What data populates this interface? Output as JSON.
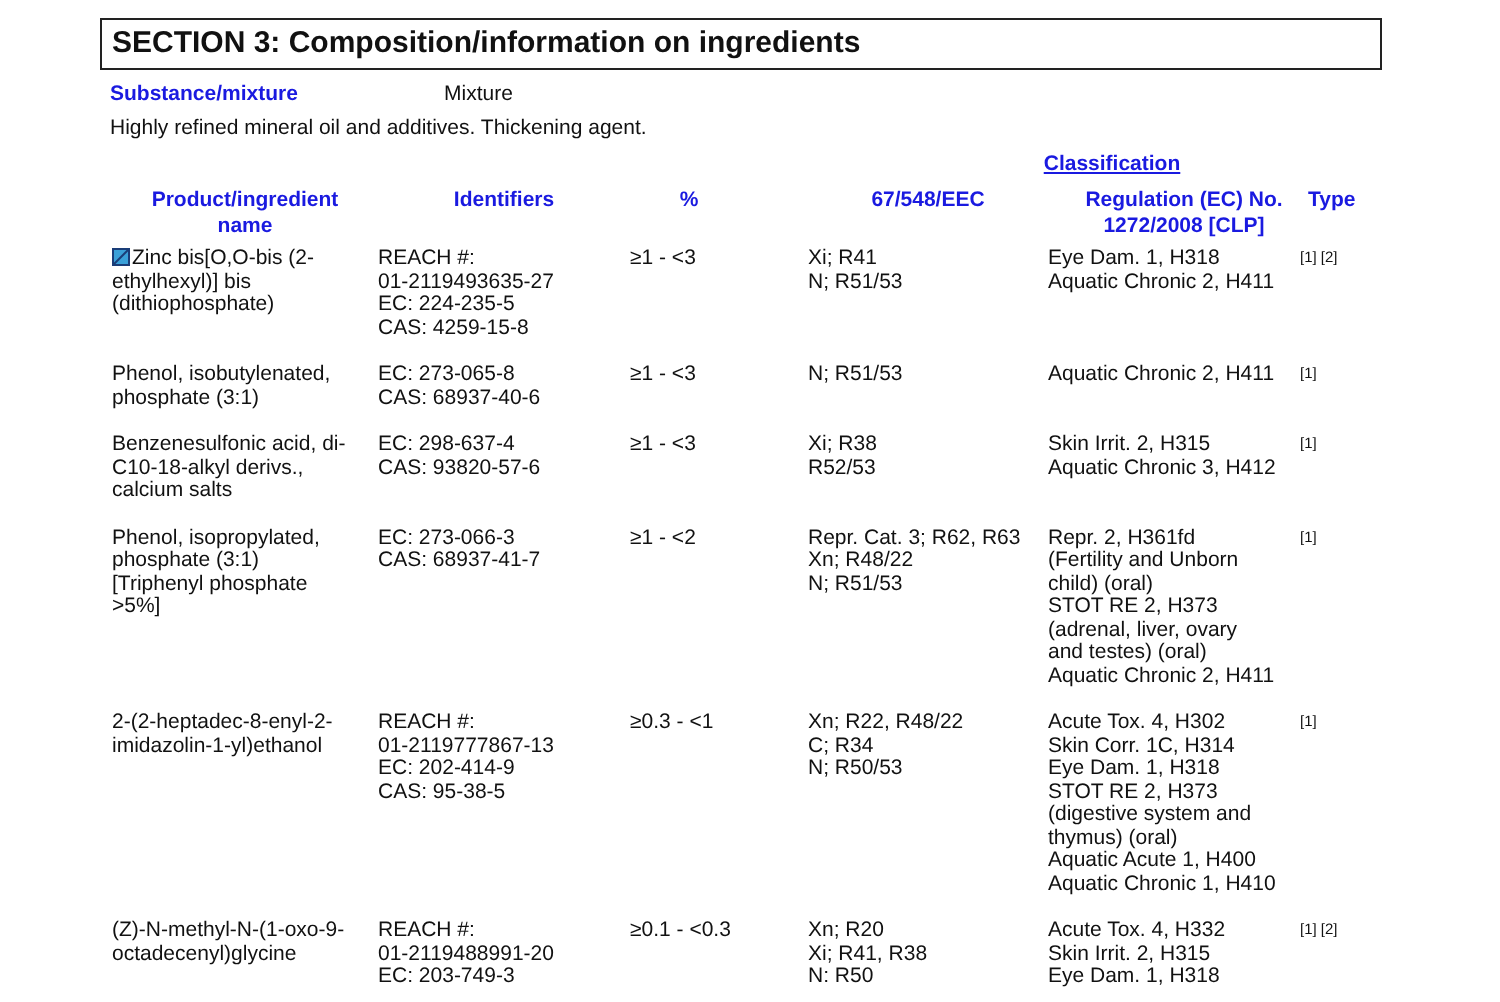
{
  "section_title": "SECTION 3: Composition/information on ingredients",
  "substance": {
    "label": "Substance/mixture",
    "value": "Mixture"
  },
  "description": "Highly refined mineral oil and additives.  Thickening agent.",
  "table": {
    "group_heading": "Classification",
    "columns": [
      "Product/ingredient name",
      "Identifiers",
      "%",
      "67/548/EEC",
      "Regulation (EC) No. 1272/2008 [CLP]",
      "Type"
    ],
    "rows": [
      {
        "note_marker": true,
        "name": "Zinc bis[O,O-bis (2-ethylhexyl)] bis (dithiophosphate)",
        "identifiers": [
          "REACH #:",
          "01-2119493635-27",
          "EC: 224-235-5",
          "CAS: 4259-15-8"
        ],
        "percent": "≥1 - <3",
        "eec": [
          "Xi; R41",
          "N; R51/53"
        ],
        "clp": [
          "Eye Dam. 1, H318",
          "Aquatic Chronic 2, H411"
        ],
        "type": "[1] [2]"
      },
      {
        "note_marker": false,
        "name": "Phenol, isobutylenated, phosphate (3:1)",
        "identifiers": [
          "EC: 273-065-8",
          "CAS: 68937-40-6"
        ],
        "percent": "≥1 - <3",
        "eec": [
          "N; R51/53"
        ],
        "clp": [
          "Aquatic Chronic 2, H411"
        ],
        "type": "[1]"
      },
      {
        "note_marker": false,
        "name": "Benzenesulfonic acid, di-C10-18-alkyl derivs., calcium salts",
        "identifiers": [
          "EC: 298-637-4",
          "CAS: 93820-57-6"
        ],
        "percent": "≥1 - <3",
        "eec": [
          "Xi; R38",
          "R52/53"
        ],
        "clp": [
          "Skin Irrit. 2, H315",
          "Aquatic Chronic 3, H412"
        ],
        "type": "[1]"
      },
      {
        "note_marker": false,
        "name": "Phenol, isopropylated, phosphate (3:1) [Triphenyl phosphate >5%]",
        "identifiers": [
          "EC: 273-066-3",
          "CAS: 68937-41-7"
        ],
        "percent": "≥1 - <2",
        "eec": [
          "Repr. Cat. 3; R62, R63",
          "Xn; R48/22",
          "N; R51/53"
        ],
        "clp": [
          "Repr. 2, H361fd",
          "(Fertility and Unborn",
          "child) (oral)",
          "STOT RE 2, H373",
          "(adrenal, liver, ovary",
          "and testes) (oral)",
          "Aquatic Chronic 2, H411"
        ],
        "type": "[1]"
      },
      {
        "note_marker": false,
        "name": "2-(2-heptadec-8-enyl-2-imidazolin-1-yl)ethanol",
        "identifiers": [
          "REACH #:",
          "01-2119777867-13",
          "EC: 202-414-9",
          "CAS: 95-38-5"
        ],
        "percent": "≥0.3 - <1",
        "eec": [
          "Xn; R22, R48/22",
          "C; R34",
          "N; R50/53"
        ],
        "clp": [
          "Acute Tox. 4, H302",
          "Skin Corr. 1C, H314",
          "Eye Dam. 1, H318",
          "STOT RE 2, H373",
          "(digestive system and",
          "thymus) (oral)",
          "Aquatic Acute 1, H400",
          "Aquatic Chronic 1, H410"
        ],
        "type": "[1]"
      },
      {
        "note_marker": false,
        "name": "(Z)-N-methyl-N-(1-oxo-9-octadecenyl)glycine",
        "identifiers": [
          "REACH #:",
          "01-2119488991-20",
          "EC: 203-749-3"
        ],
        "percent": "≥0.1 - <0.3",
        "eec": [
          "Xn; R20",
          "Xi; R41, R38",
          "N: R50"
        ],
        "clp": [
          "Acute Tox. 4, H332",
          "Skin Irrit. 2, H315",
          "Eye Dam. 1, H318"
        ],
        "type": "[1] [2]"
      }
    ]
  }
}
